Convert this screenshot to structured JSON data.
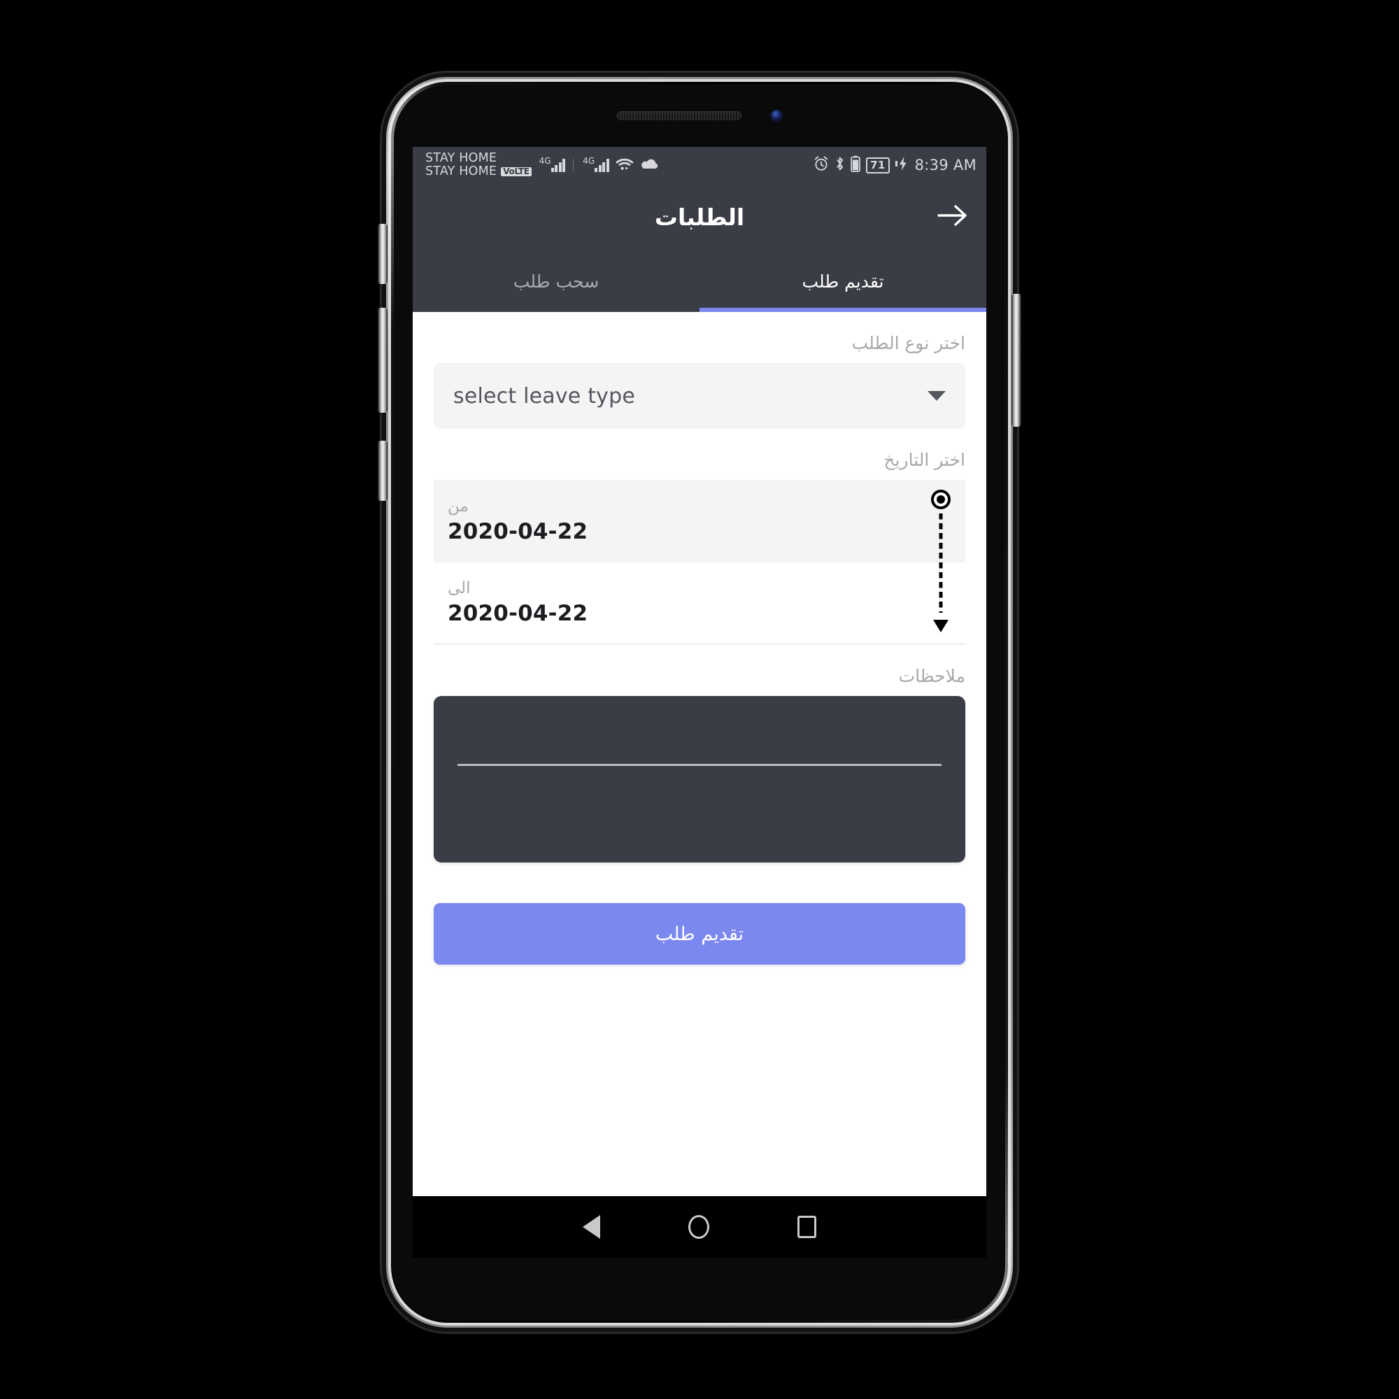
{
  "status_bar": {
    "carrier_line_1": "STAY HOME",
    "carrier_line_2": "STAY HOME",
    "volte_badge": "VoLTE",
    "network_type_1": "4G",
    "network_type_2": "4G",
    "icons": [
      "alarm-icon",
      "bluetooth-icon",
      "battery-icon",
      "charging-bolt-icon",
      "wifi-icon",
      "cloud-icon"
    ],
    "battery_percent": "71",
    "time": "8:39 AM"
  },
  "app_bar": {
    "title": "الطلبات",
    "back_icon": "arrow-right-icon"
  },
  "tabs": [
    {
      "label": "تقديم طلب",
      "active": true
    },
    {
      "label": "سحب طلب",
      "active": false
    }
  ],
  "form": {
    "leave_type": {
      "label": "اختر نوع الطلب",
      "value": "select leave type",
      "caret_icon": "chevron-down-icon"
    },
    "date": {
      "label": "اختر التاريخ",
      "from_caption": "من",
      "from_value": "2020-04-22",
      "to_caption": "الى",
      "to_value": "2020-04-22"
    },
    "notes": {
      "label": "ملاحظات",
      "value": "",
      "placeholder": ""
    },
    "submit_label": "تقديم طلب"
  },
  "android_nav": {
    "back_icon": "triangle-back-icon",
    "home_icon": "circle-home-icon",
    "recents_icon": "square-recents-icon"
  },
  "colors": {
    "app_bar_bg": "#3b3d46",
    "accent": "#7b88f0",
    "field_bg": "#f4f4f4",
    "notes_bg": "#3b3d46",
    "label_text": "#a8a8ad"
  }
}
